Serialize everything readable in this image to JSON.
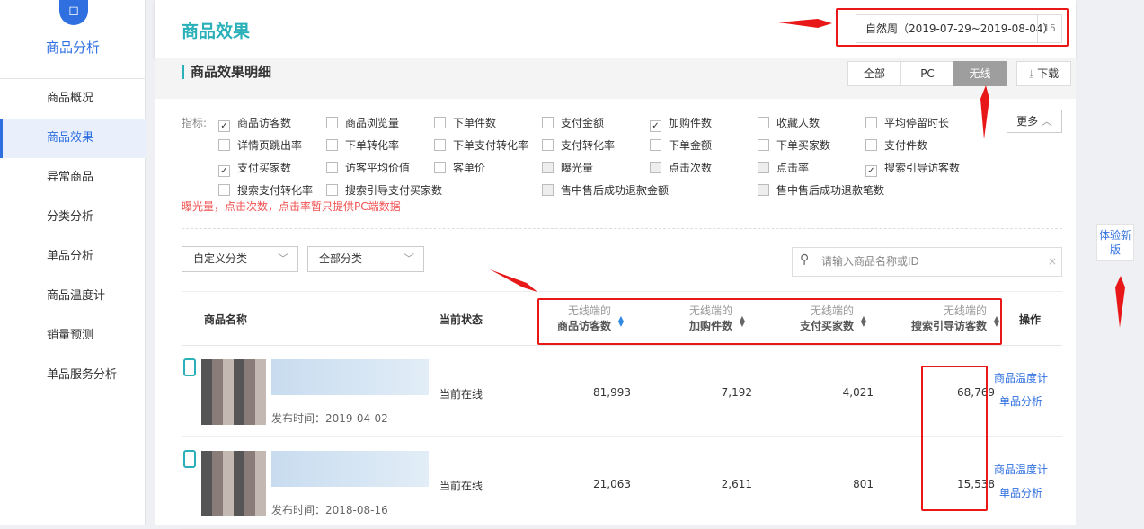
{
  "sidebar": {
    "title": "商品分析",
    "items": [
      "商品概况",
      "商品效果",
      "异常商品",
      "分类分析",
      "单品分析",
      "商品温度计",
      "销量预测",
      "单品服务分析"
    ],
    "active": 1
  },
  "header": {
    "title": "商品效果",
    "date_range": "自然周（2019-07-29~2019-08-04）",
    "calendar_num": "15"
  },
  "section": {
    "title": "商品效果明细",
    "segments": [
      "全部",
      "PC",
      "无线"
    ],
    "active_segment": "无线",
    "download": "下载",
    "more": "更多"
  },
  "indicators": {
    "label": "指标:",
    "items": [
      {
        "label": "商品访客数",
        "checked": true
      },
      {
        "label": "商品浏览量",
        "checked": false
      },
      {
        "label": "下单件数",
        "checked": false
      },
      {
        "label": "支付金额",
        "checked": false
      },
      {
        "label": "加购件数",
        "checked": true
      },
      {
        "label": "收藏人数",
        "checked": false
      },
      {
        "label": "平均停留时长",
        "checked": false
      },
      {
        "label": "详情页跳出率",
        "checked": false
      },
      {
        "label": "下单转化率",
        "checked": false
      },
      {
        "label": "下单支付转化率",
        "checked": false
      },
      {
        "label": "支付转化率",
        "checked": false
      },
      {
        "label": "下单金额",
        "checked": false
      },
      {
        "label": "下单买家数",
        "checked": false
      },
      {
        "label": "支付件数",
        "checked": false
      },
      {
        "label": "支付买家数",
        "checked": true
      },
      {
        "label": "访客平均价值",
        "checked": false
      },
      {
        "label": "客单价",
        "checked": false
      },
      {
        "label": "曝光量",
        "checked": false,
        "disabled": true
      },
      {
        "label": "点击次数",
        "checked": false,
        "disabled": true
      },
      {
        "label": "点击率",
        "checked": false,
        "disabled": true
      },
      {
        "label": "搜索引导访客数",
        "checked": true
      },
      {
        "label": "搜索支付转化率",
        "checked": false
      },
      {
        "label": "搜索引导支付买家数",
        "checked": false
      },
      {
        "label": "售中售后成功退款金额",
        "checked": false,
        "disabled": true
      },
      {
        "label": "售中售后成功退款笔数",
        "checked": false,
        "disabled": true
      }
    ],
    "note": "曝光量，点击次数，点击率暂只提供PC端数据"
  },
  "filters": {
    "category1": "自定义分类",
    "category2": "全部分类",
    "search_placeholder": "请输入商品名称或ID"
  },
  "table": {
    "headers": {
      "name": "商品名称",
      "status": "当前状态",
      "prefix": "无线端的",
      "metrics": [
        "商品访客数",
        "加购件数",
        "支付买家数",
        "搜索引导访客数"
      ],
      "action": "操作"
    },
    "rows": [
      {
        "published": "发布时间：2019-04-02",
        "status": "当前在线",
        "values": [
          "81,993",
          "7,192",
          "4,021",
          "68,769"
        ],
        "actions": [
          "商品温度计",
          "单品分析"
        ]
      },
      {
        "published": "发布时间：2018-08-16",
        "status": "当前在线",
        "values": [
          "21,063",
          "2,611",
          "801",
          "15,538"
        ],
        "actions": [
          "商品温度计",
          "单品分析"
        ]
      }
    ]
  },
  "new_version": "体验新版",
  "colors": {
    "accent": "#2ab0b8",
    "link": "#2f6fe0",
    "annotation": "#e81818"
  }
}
